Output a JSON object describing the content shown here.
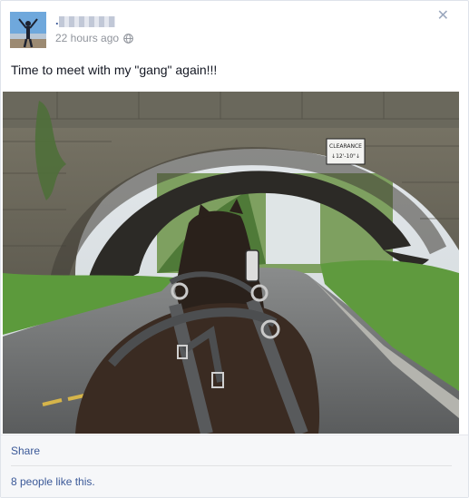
{
  "post": {
    "author": ".",
    "timestamp": "22 hours ago",
    "message": "Time to meet with my \"gang\" again!!!",
    "sign_text": "CLEARANCE 12'-10\""
  },
  "actions": {
    "share_label": "Share",
    "likes_text": "8 people like this."
  },
  "icons": {
    "privacy": "globe-icon",
    "close": "close-icon"
  },
  "colors": {
    "link": "#3b5998",
    "meta": "#90949c",
    "footer_bg": "#f6f7f9"
  }
}
